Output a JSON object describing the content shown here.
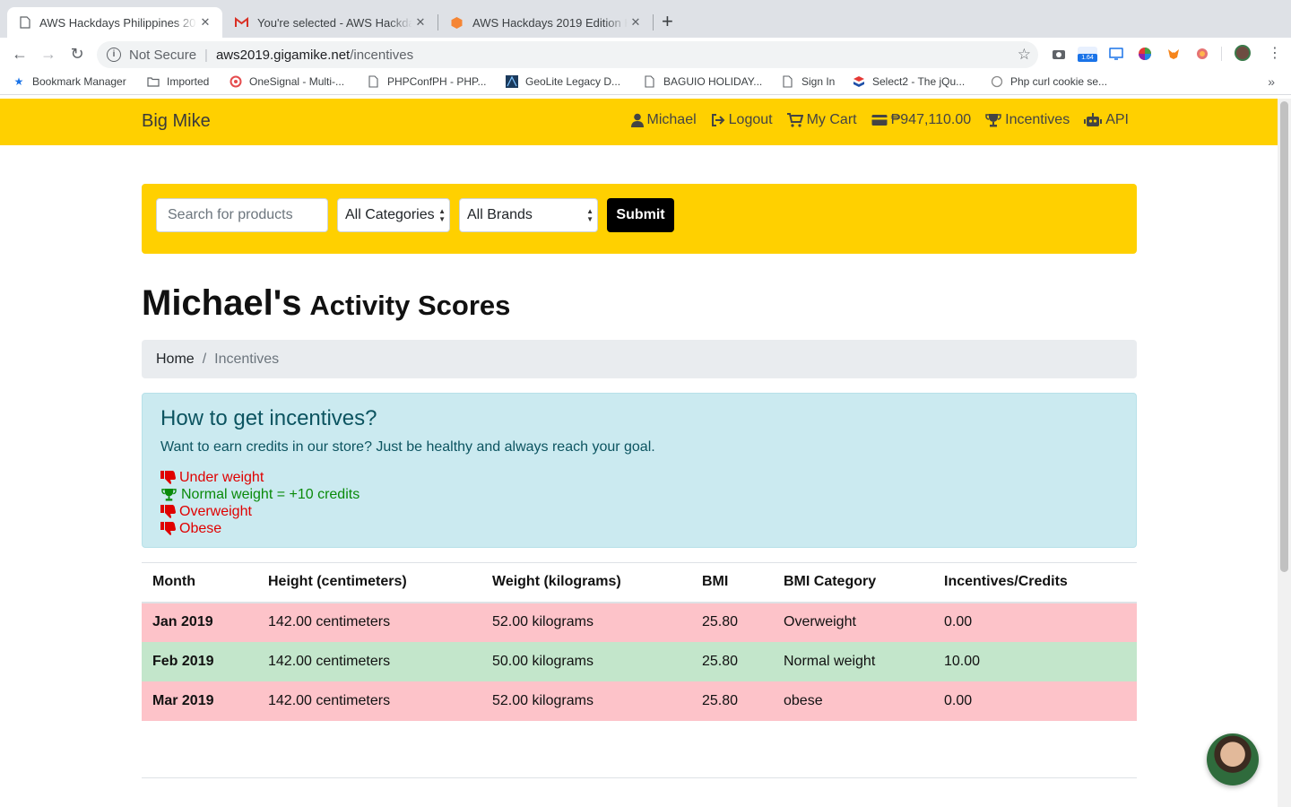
{
  "browser": {
    "tabs": [
      {
        "title": "AWS Hackdays Philippines 2019",
        "icon": "document-icon"
      },
      {
        "title": "You're selected - AWS Hackdays",
        "icon": "gmail-icon"
      },
      {
        "title": "AWS Hackdays 2019 Edition Ha",
        "icon": "aws-cube-icon"
      }
    ],
    "omnibox": {
      "security_label": "Not Secure",
      "host": "aws2019.gigamike.net",
      "path": "/incentives"
    },
    "extension_badge": "1.64",
    "bookmarks": [
      {
        "label": "Bookmark Manager",
        "icon": "star-icon"
      },
      {
        "label": "Imported",
        "icon": "folder-icon"
      },
      {
        "label": "OneSignal - Multi-...",
        "icon": "onesignal-icon"
      },
      {
        "label": "PHPConfPH - PHP...",
        "icon": "document-icon"
      },
      {
        "label": "GeoLite Legacy D...",
        "icon": "geolite-icon"
      },
      {
        "label": "BAGUIO HOLIDAY...",
        "icon": "document-icon"
      },
      {
        "label": "Sign In",
        "icon": "document-icon"
      },
      {
        "label": "Select2 - The jQu...",
        "icon": "select2-icon"
      },
      {
        "label": "Php curl cookie se...",
        "icon": "globe-icon"
      }
    ]
  },
  "navbar": {
    "brand": "Big Mike",
    "links": {
      "user": "Michael",
      "logout": "Logout",
      "cart": "My Cart",
      "balance": "₱947,110.00",
      "incentives": "Incentives",
      "api": "API"
    }
  },
  "search": {
    "placeholder": "Search for products",
    "category": "All Categories",
    "brand": "All Brands",
    "submit": "Submit"
  },
  "page": {
    "title_name": "Michael's",
    "title_sub": "Activity Scores"
  },
  "breadcrumb": {
    "home": "Home",
    "separator": "/",
    "current": "Incentives"
  },
  "info": {
    "heading": "How to get incentives?",
    "description": "Want to earn credits in our store? Just be healthy and always reach your goal.",
    "rules": {
      "underweight": "Under weight",
      "normal": "Normal weight = +10 credits",
      "overweight": "Overweight",
      "obese": "Obese"
    }
  },
  "table": {
    "headers": [
      "Month",
      "Height (centimeters)",
      "Weight (kilograms)",
      "BMI",
      "BMI Category",
      "Incentives/Credits"
    ],
    "rows": [
      {
        "month": "Jan 2019",
        "height": "142.00 centimeters",
        "weight": "52.00 kilograms",
        "bmi": "25.80",
        "category": "Overweight",
        "credits": "0.00",
        "status": "danger"
      },
      {
        "month": "Feb 2019",
        "height": "142.00 centimeters",
        "weight": "50.00 kilograms",
        "bmi": "25.80",
        "category": "Normal weight",
        "credits": "10.00",
        "status": "success"
      },
      {
        "month": "Mar 2019",
        "height": "142.00 centimeters",
        "weight": "52.00 kilograms",
        "bmi": "25.80",
        "category": "obese",
        "credits": "0.00",
        "status": "danger"
      }
    ]
  },
  "colors": {
    "navbar": "#ffd000",
    "danger_row": "#fdc3c9",
    "success_row": "#c3e6cb",
    "alert_bg": "#cbeaf0"
  }
}
